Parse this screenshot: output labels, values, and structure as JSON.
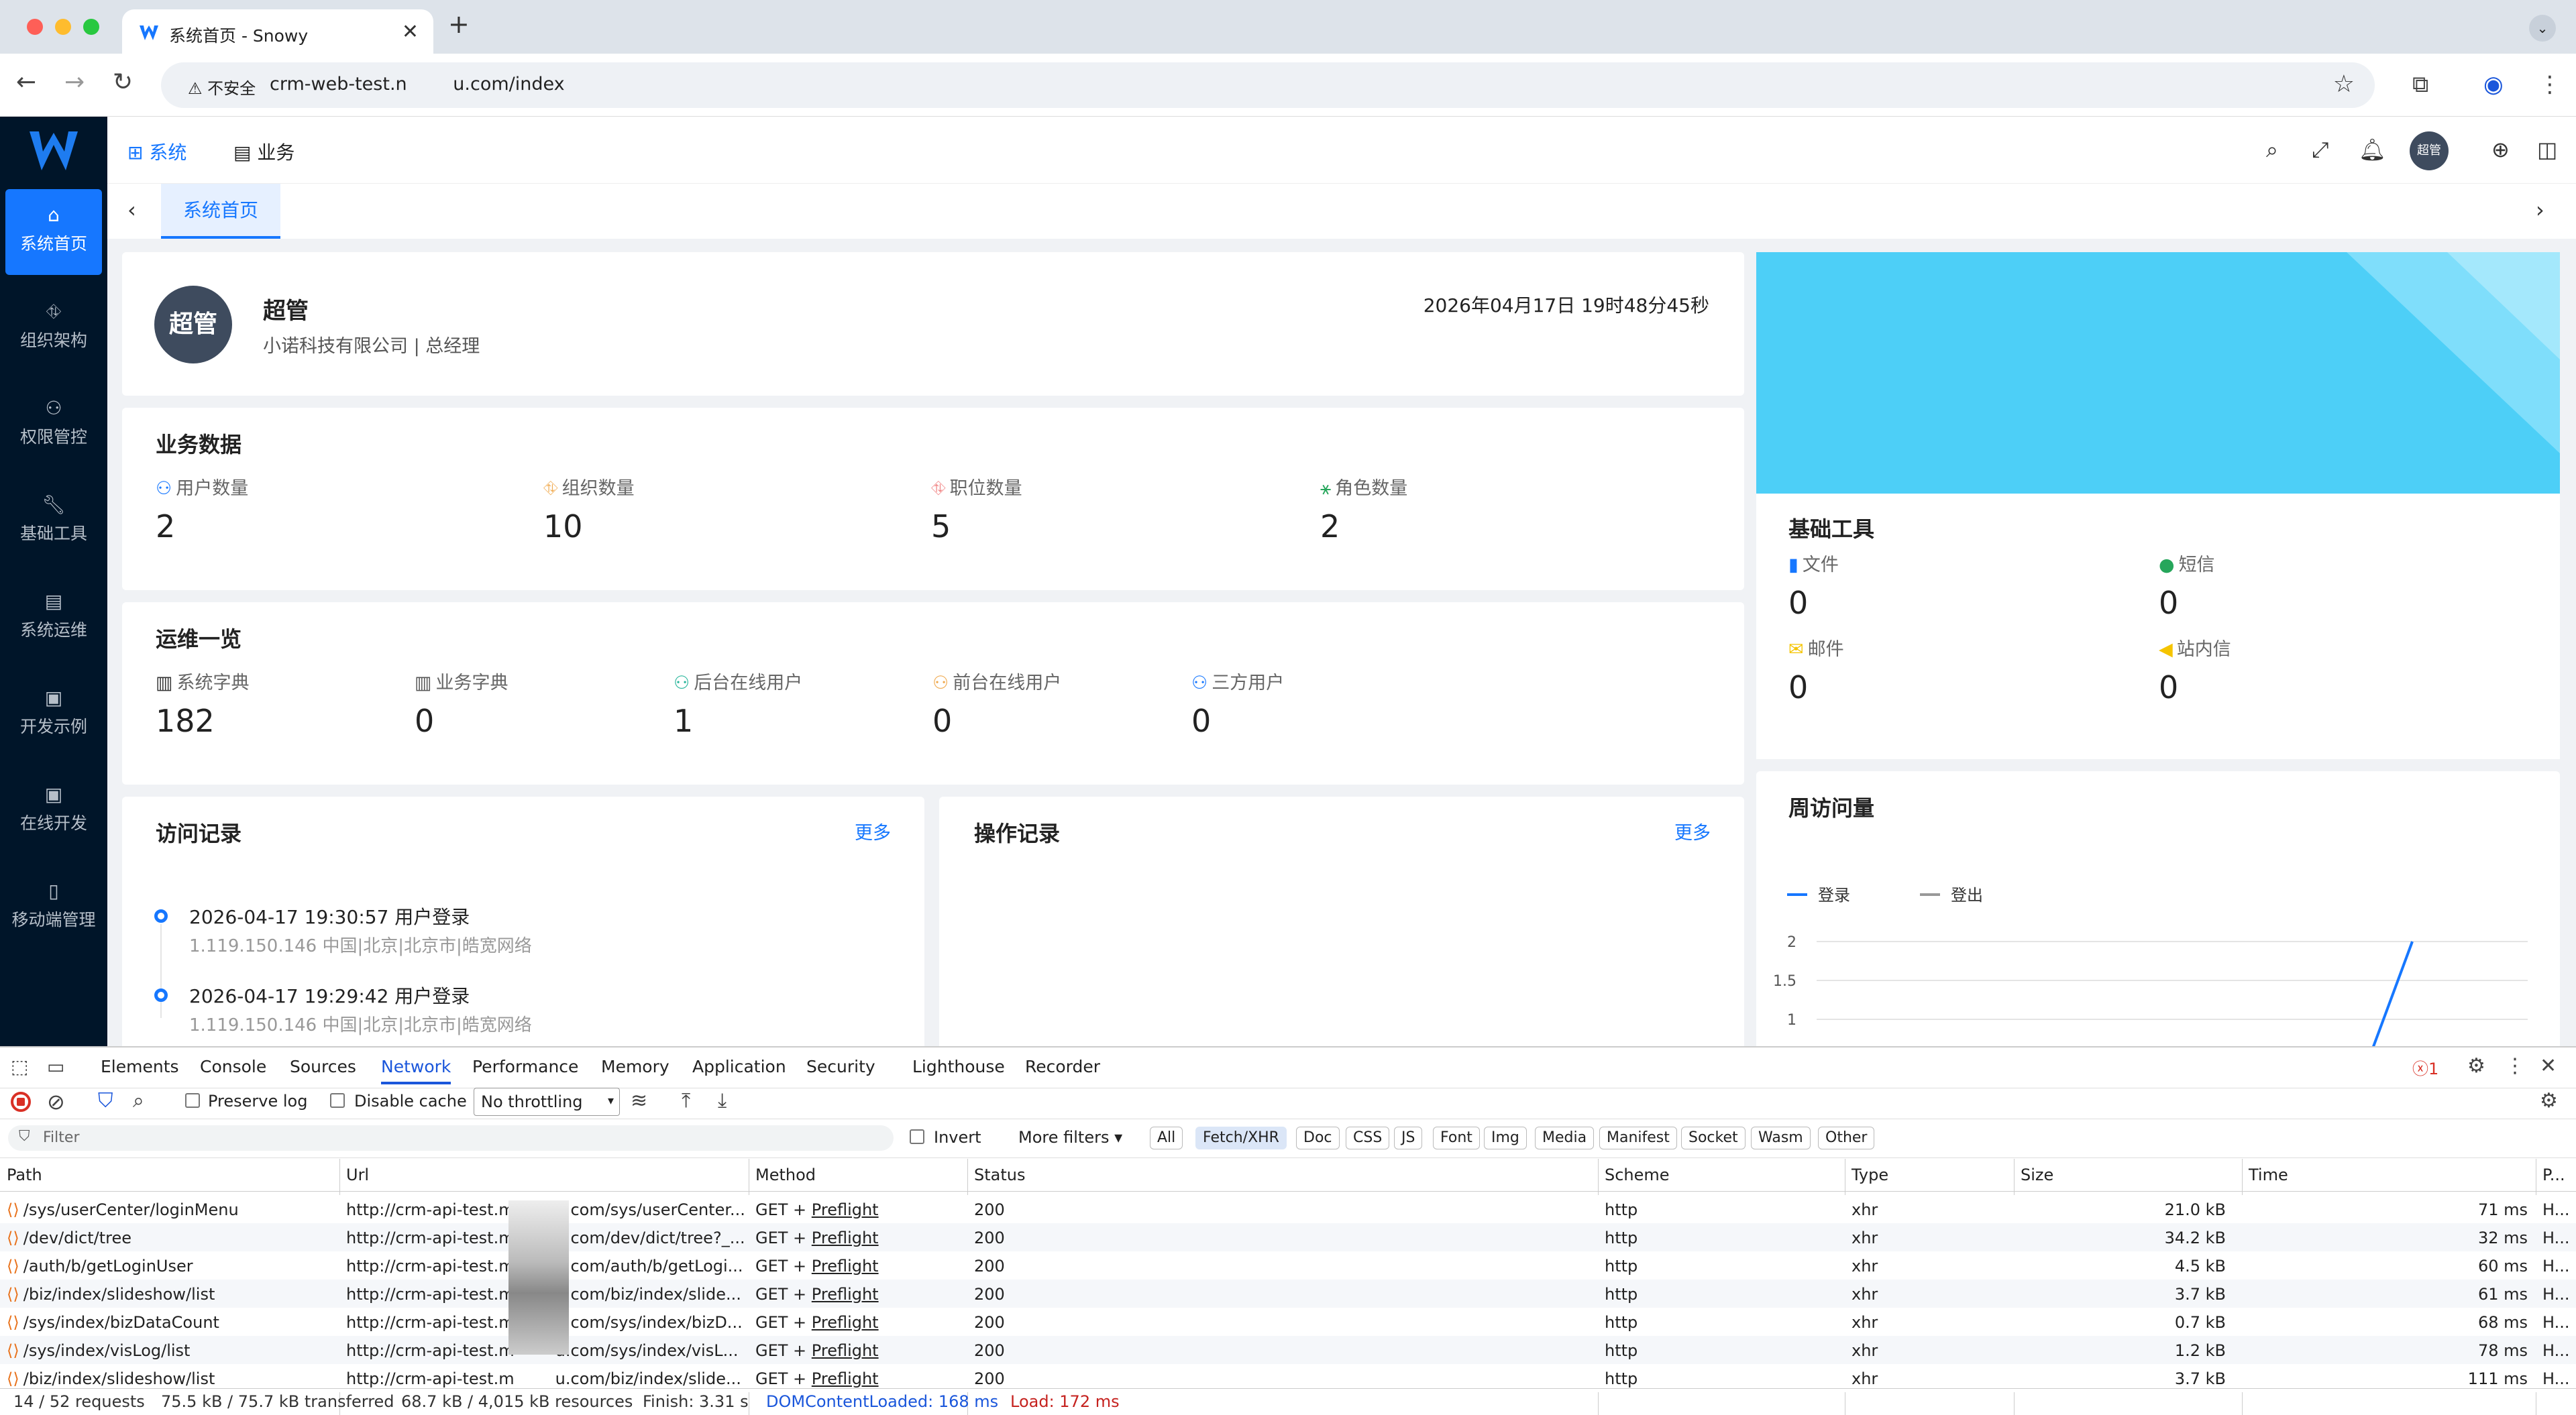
{
  "browser": {
    "tab_title": "系统首页 - Snowy",
    "security_label": "不安全",
    "url": "crm-web-test.n        u.com/index"
  },
  "app": {
    "modules": [
      "系统",
      "业务"
    ],
    "avatar_text": "超管",
    "page_tab": "系统首页",
    "sidebar": [
      {
        "label": "系统首页",
        "icon": "home-icon",
        "active": true
      },
      {
        "label": "组织架构",
        "icon": "org-icon"
      },
      {
        "label": "权限管控",
        "icon": "user-icon"
      },
      {
        "label": "基础工具",
        "icon": "wrench-icon"
      },
      {
        "label": "系统运维",
        "icon": "server-icon"
      },
      {
        "label": "开发示例",
        "icon": "window-icon"
      },
      {
        "label": "在线开发",
        "icon": "window-icon"
      },
      {
        "label": "移动端管理",
        "icon": "mobile-icon"
      }
    ]
  },
  "profile": {
    "avatar": "超管",
    "name": "超管",
    "org": "小诺科技有限公司 | 总经理",
    "datetime": "2026年04月17日 19时48分45秒"
  },
  "biz": {
    "title": "业务数据",
    "items": [
      {
        "label": "用户数量",
        "value": "2",
        "icon": "user-icon",
        "color": "#1677ff"
      },
      {
        "label": "组织数量",
        "value": "10",
        "icon": "org-icon",
        "color": "#f0a94d"
      },
      {
        "label": "职位数量",
        "value": "5",
        "icon": "position-icon",
        "color": "#f07e7e"
      },
      {
        "label": "角色数量",
        "value": "2",
        "icon": "role-icon",
        "color": "#26a65b"
      }
    ]
  },
  "ops": {
    "title": "运维一览",
    "items": [
      {
        "label": "系统字典",
        "value": "182",
        "icon": "dict-icon",
        "color": "#333"
      },
      {
        "label": "业务字典",
        "value": "0",
        "icon": "book-icon",
        "color": "#555"
      },
      {
        "label": "后台在线用户",
        "value": "1",
        "icon": "online-icon",
        "color": "#26b59a"
      },
      {
        "label": "前台在线用户",
        "value": "0",
        "icon": "user-icon",
        "color": "#f0a94d"
      },
      {
        "label": "三方用户",
        "value": "0",
        "icon": "users-icon",
        "color": "#1677ff"
      }
    ]
  },
  "visits": {
    "title": "访问记录",
    "more": "更多",
    "items": [
      {
        "line1": "2026-04-17 19:30:57 用户登录",
        "line2": "1.119.150.146 中国|北京|北京市|皓宽网络"
      },
      {
        "line1": "2026-04-17 19:29:42 用户登录",
        "line2": "1.119.150.146 中国|北京|北京市|皓宽网络"
      }
    ]
  },
  "oplog": {
    "title": "操作记录",
    "more": "更多"
  },
  "tools": {
    "title": "基础工具",
    "items": [
      {
        "label": "文件",
        "value": "0",
        "icon": "file-icon",
        "color": "#1677ff"
      },
      {
        "label": "短信",
        "value": "0",
        "icon": "chat-icon",
        "color": "#26a65b"
      },
      {
        "label": "邮件",
        "value": "0",
        "icon": "mail-icon",
        "color": "#f5c400"
      },
      {
        "label": "站内信",
        "value": "0",
        "icon": "megaphone-icon",
        "color": "#f5c400"
      }
    ]
  },
  "weekly": {
    "title": "周访问量",
    "legend": [
      "登录",
      "登出"
    ],
    "yticks": [
      "2",
      "1.5",
      "1"
    ]
  },
  "chart_data": {
    "type": "line",
    "title": "周访问量",
    "series": [
      {
        "name": "登录",
        "values": [
          0,
          2
        ]
      },
      {
        "name": "登出",
        "values": [
          0,
          0
        ]
      }
    ],
    "yticks": [
      1,
      1.5,
      2
    ],
    "legend_position": "top-left",
    "grid": true
  },
  "devtools": {
    "tabs": [
      "Elements",
      "Console",
      "Sources",
      "Network",
      "Performance",
      "Memory",
      "Application",
      "Security",
      "Lighthouse",
      "Recorder"
    ],
    "active_tab": "Network",
    "error_count": "1",
    "preserve_log": "Preserve log",
    "disable_cache": "Disable cache",
    "throttle": "No throttling",
    "filter_placeholder": "Filter",
    "invert": "Invert",
    "more_filters": "More filters",
    "types": [
      "All",
      "Fetch/XHR",
      "Doc",
      "CSS",
      "JS",
      "Font",
      "Img",
      "Media",
      "Manifest",
      "Socket",
      "Wasm",
      "Other"
    ],
    "active_type": "Fetch/XHR",
    "columns": [
      "Path",
      "Url",
      "Method",
      "Status",
      "Scheme",
      "Type",
      "Size",
      "Time",
      "P..."
    ],
    "rows": [
      {
        "path": "/sys/userCenter/loginMenu",
        "url": "http://crm-api-test.m        u.com/sys/userCenter...",
        "method": "GET + ",
        "pre": "Preflight",
        "status": "200",
        "scheme": "http",
        "type": "xhr",
        "size": "21.0 kB",
        "time": "71 ms",
        "p": "H..."
      },
      {
        "path": "/dev/dict/tree",
        "url": "http://crm-api-test.m        u.com/dev/dict/tree?_...",
        "method": "GET + ",
        "pre": "Preflight",
        "status": "200",
        "scheme": "http",
        "type": "xhr",
        "size": "34.2 kB",
        "time": "32 ms",
        "p": "H..."
      },
      {
        "path": "/auth/b/getLoginUser",
        "url": "http://crm-api-test.m        u.com/auth/b/getLogi...",
        "method": "GET + ",
        "pre": "Preflight",
        "status": "200",
        "scheme": "http",
        "type": "xhr",
        "size": "4.5 kB",
        "time": "60 ms",
        "p": "H..."
      },
      {
        "path": "/biz/index/slideshow/list",
        "url": "http://crm-api-test.m        u.com/biz/index/slide...",
        "method": "GET + ",
        "pre": "Preflight",
        "status": "200",
        "scheme": "http",
        "type": "xhr",
        "size": "3.7 kB",
        "time": "61 ms",
        "p": "H..."
      },
      {
        "path": "/sys/index/bizDataCount",
        "url": "http://crm-api-test.m        u.com/sys/index/bizD...",
        "method": "GET + ",
        "pre": "Preflight",
        "status": "200",
        "scheme": "http",
        "type": "xhr",
        "size": "0.7 kB",
        "time": "68 ms",
        "p": "H..."
      },
      {
        "path": "/sys/index/visLog/list",
        "url": "http://crm-api-test.m        u.com/sys/index/visL...",
        "method": "GET + ",
        "pre": "Preflight",
        "status": "200",
        "scheme": "http",
        "type": "xhr",
        "size": "1.2 kB",
        "time": "78 ms",
        "p": "H..."
      },
      {
        "path": "/biz/index/slideshow/list",
        "url": "http://crm-api-test.m        u.com/biz/index/slide...",
        "method": "GET + ",
        "pre": "Preflight",
        "status": "200",
        "scheme": "http",
        "type": "xhr",
        "size": "3.7 kB",
        "time": "111 ms",
        "p": "H..."
      }
    ],
    "status": {
      "requests": "14 / 52 requests",
      "transferred": "75.5 kB / 75.7 kB transferred",
      "resources": "68.7 kB / 4,015 kB resources",
      "finish": "Finish: 3.31 s",
      "dcl": "DOMContentLoaded: 168 ms",
      "load": "Load: 172 ms"
    }
  },
  "colors": {
    "accent": "#1677ff",
    "sidebar": "#001529",
    "banner": "#4dcff7"
  }
}
